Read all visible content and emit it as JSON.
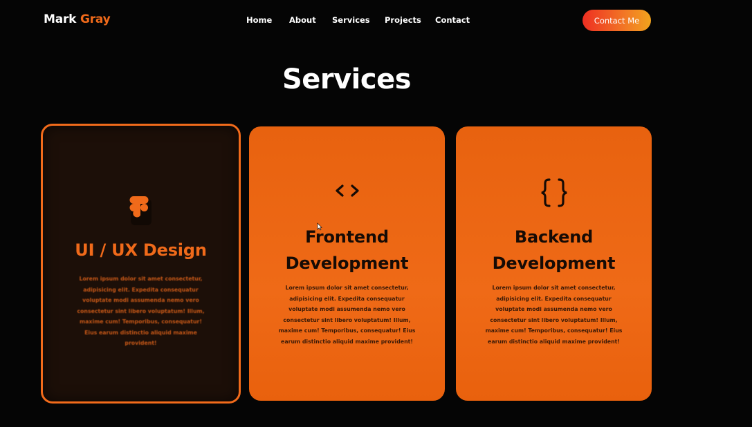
{
  "header": {
    "logo_first": "Mark",
    "logo_second": "Gray",
    "nav": [
      "Home",
      "About",
      "Services",
      "Projects",
      "Contact"
    ],
    "cta_label": "Contact Me"
  },
  "section_title": "Services",
  "cards": [
    {
      "title": "UI / UX Design",
      "icon": "figma-icon",
      "description": "Lorem ipsum dolor sit amet consectetur, adipisicing elit. Expedita consequatur voluptate modi assumenda nemo vero consectetur sint libero voluptatum! Illum, maxime cum! Temporibus, consequatur! Eius earum distinctio aliquid maxime provident!"
    },
    {
      "title": "Frontend Development",
      "icon": "code-icon",
      "description": "Lorem ipsum dolor sit amet consectetur, adipisicing elit. Expedita consequatur voluptate modi assumenda nemo vero consectetur sint libero voluptatum! Illum, maxime cum! Temporibus, consequatur! Eius earum distinctio aliquid maxime provident!"
    },
    {
      "title": "Backend Development",
      "icon": "curly-braces-icon",
      "description": "Lorem ipsum dolor sit amet consectetur, adipisicing elit. Expedita consequatur voluptate modi assumenda nemo vero consectetur sint libero voluptatum! Illum, maxime cum! Temporibus, consequatur! Eius earum distinctio aliquid maxime provident!"
    }
  ],
  "colors": {
    "accent": "#f06a1a",
    "card": "#ee6716",
    "card_dark": "#1c0f08",
    "background": "#050505"
  }
}
